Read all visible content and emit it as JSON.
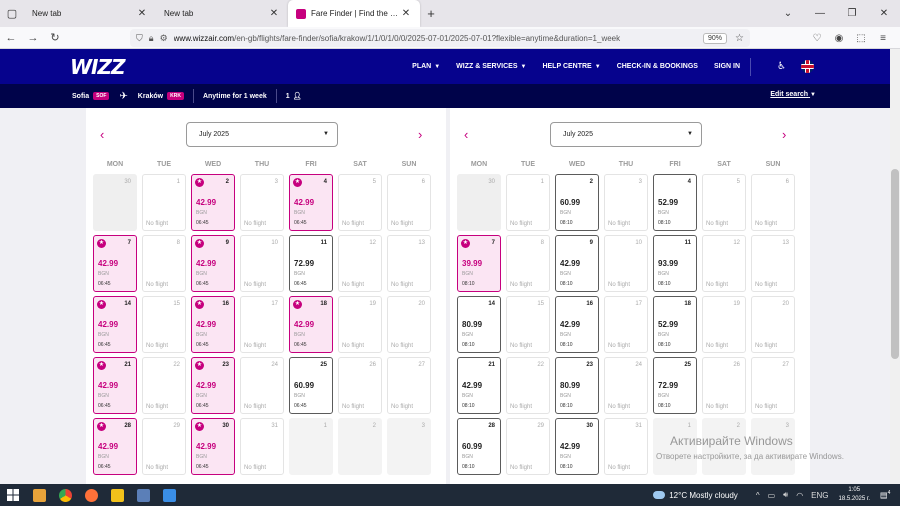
{
  "browser": {
    "tabs": [
      {
        "title": "New tab",
        "active": false
      },
      {
        "title": "New tab",
        "active": false
      },
      {
        "title": "Fare Finder | Find the Cheapest",
        "active": true
      }
    ],
    "new_tab": "+",
    "url_domain": "www.wizzair.com",
    "url_path": "/en-gb/flights/fare-finder/sofia/krakow/1/1/0/1/0/0/2025-07-01/2025-07-01?flexible=anytime&duration=1_week",
    "zoom": "90%"
  },
  "site": {
    "logo": "WIZZ",
    "nav": [
      {
        "label": "PLAN",
        "caret": true
      },
      {
        "label": "WIZZ & SERVICES",
        "caret": true
      },
      {
        "label": "HELP CENTRE",
        "caret": true
      },
      {
        "label": "CHECK-IN & BOOKINGS",
        "caret": false
      },
      {
        "label": "SIGN IN",
        "caret": false
      }
    ],
    "search": {
      "origin": "Sofia",
      "origin_code": "SOF",
      "destination": "Kraków",
      "destination_code": "KRK",
      "duration": "Anytime for 1 week",
      "passengers": "1",
      "edit": "Edit search"
    }
  },
  "calendar": {
    "weekdays": [
      "MON",
      "TUE",
      "WED",
      "THU",
      "FRI",
      "SAT",
      "SUN"
    ],
    "no_flight": "No flight",
    "currency": "BGN",
    "panels": [
      {
        "month": "July 2025",
        "days": [
          {
            "n": "30",
            "s": "empty"
          },
          {
            "n": "1",
            "s": "nf"
          },
          {
            "n": "2",
            "s": "cheap",
            "price": "42.99",
            "time": "06:45"
          },
          {
            "n": "3",
            "s": "nf"
          },
          {
            "n": "4",
            "s": "cheap",
            "price": "42.99",
            "time": "06:45"
          },
          {
            "n": "5",
            "s": "nf"
          },
          {
            "n": "6",
            "s": "nf"
          },
          {
            "n": "7",
            "s": "cheap",
            "price": "42.99",
            "time": "06:45"
          },
          {
            "n": "8",
            "s": "nf"
          },
          {
            "n": "9",
            "s": "cheap",
            "price": "42.99",
            "time": "06:45"
          },
          {
            "n": "10",
            "s": "nf"
          },
          {
            "n": "11",
            "s": "avail",
            "price": "72.99",
            "time": "06:45"
          },
          {
            "n": "12",
            "s": "nf"
          },
          {
            "n": "13",
            "s": "nf"
          },
          {
            "n": "14",
            "s": "cheap",
            "price": "42.99",
            "time": "06:45"
          },
          {
            "n": "15",
            "s": "nf"
          },
          {
            "n": "16",
            "s": "cheap",
            "price": "42.99",
            "time": "06:45"
          },
          {
            "n": "17",
            "s": "nf"
          },
          {
            "n": "18",
            "s": "cheap",
            "price": "42.99",
            "time": "06:45"
          },
          {
            "n": "19",
            "s": "nf"
          },
          {
            "n": "20",
            "s": "nf"
          },
          {
            "n": "21",
            "s": "cheap",
            "price": "42.99",
            "time": "06:45"
          },
          {
            "n": "22",
            "s": "nf"
          },
          {
            "n": "23",
            "s": "cheap",
            "price": "42.99",
            "time": "06:45"
          },
          {
            "n": "24",
            "s": "nf"
          },
          {
            "n": "25",
            "s": "avail",
            "price": "60.99",
            "time": "06:45"
          },
          {
            "n": "26",
            "s": "nf"
          },
          {
            "n": "27",
            "s": "nf"
          },
          {
            "n": "28",
            "s": "cheap",
            "price": "42.99",
            "time": "06:45"
          },
          {
            "n": "29",
            "s": "nf"
          },
          {
            "n": "30",
            "s": "cheap",
            "price": "42.99",
            "time": "06:45"
          },
          {
            "n": "31",
            "s": "nf"
          },
          {
            "n": "1",
            "s": "out"
          },
          {
            "n": "2",
            "s": "out"
          },
          {
            "n": "3",
            "s": "out"
          }
        ]
      },
      {
        "month": "July 2025",
        "days": [
          {
            "n": "30",
            "s": "empty"
          },
          {
            "n": "1",
            "s": "nf"
          },
          {
            "n": "2",
            "s": "avail",
            "price": "60.99",
            "time": "08:10"
          },
          {
            "n": "3",
            "s": "nf"
          },
          {
            "n": "4",
            "s": "avail",
            "price": "52.99",
            "time": "08:10"
          },
          {
            "n": "5",
            "s": "nf"
          },
          {
            "n": "6",
            "s": "nf"
          },
          {
            "n": "7",
            "s": "cheap",
            "price": "39.99",
            "time": "08:10"
          },
          {
            "n": "8",
            "s": "nf"
          },
          {
            "n": "9",
            "s": "avail",
            "price": "42.99",
            "time": "08:10"
          },
          {
            "n": "10",
            "s": "nf"
          },
          {
            "n": "11",
            "s": "avail",
            "price": "93.99",
            "time": "08:10"
          },
          {
            "n": "12",
            "s": "nf"
          },
          {
            "n": "13",
            "s": "nf"
          },
          {
            "n": "14",
            "s": "avail",
            "price": "80.99",
            "time": "08:10"
          },
          {
            "n": "15",
            "s": "nf"
          },
          {
            "n": "16",
            "s": "avail",
            "price": "42.99",
            "time": "08:10"
          },
          {
            "n": "17",
            "s": "nf"
          },
          {
            "n": "18",
            "s": "avail",
            "price": "52.99",
            "time": "08:10"
          },
          {
            "n": "19",
            "s": "nf"
          },
          {
            "n": "20",
            "s": "nf"
          },
          {
            "n": "21",
            "s": "avail",
            "price": "42.99",
            "time": "08:10"
          },
          {
            "n": "22",
            "s": "nf"
          },
          {
            "n": "23",
            "s": "avail",
            "price": "80.99",
            "time": "08:10"
          },
          {
            "n": "24",
            "s": "nf"
          },
          {
            "n": "25",
            "s": "avail",
            "price": "72.99",
            "time": "08:10"
          },
          {
            "n": "26",
            "s": "nf"
          },
          {
            "n": "27",
            "s": "nf"
          },
          {
            "n": "28",
            "s": "avail",
            "price": "60.99",
            "time": "08:10"
          },
          {
            "n": "29",
            "s": "nf"
          },
          {
            "n": "30",
            "s": "avail",
            "price": "42.99",
            "time": "08:10"
          },
          {
            "n": "31",
            "s": "nf"
          },
          {
            "n": "1",
            "s": "out"
          },
          {
            "n": "2",
            "s": "out"
          },
          {
            "n": "3",
            "s": "out"
          }
        ]
      }
    ]
  },
  "watermark": {
    "line1": "Активирайте Windows",
    "line2": "Отворете настройките, за да активирате Windows."
  },
  "taskbar": {
    "temperature": "12°C",
    "weather": "Mostly cloudy",
    "language": "ENG",
    "time": "1:05",
    "date": "18.5.2025 г.",
    "notifications": "4",
    "app_colors": [
      "#e8a33a",
      "#ffffff",
      "#ff7139",
      "#f2c21b",
      "#5b7fb8",
      "#3a8ee6"
    ]
  },
  "colors": {
    "brand_blue": "#06038d",
    "dark_bar": "#00034a",
    "accent_pink": "#c6007e"
  }
}
